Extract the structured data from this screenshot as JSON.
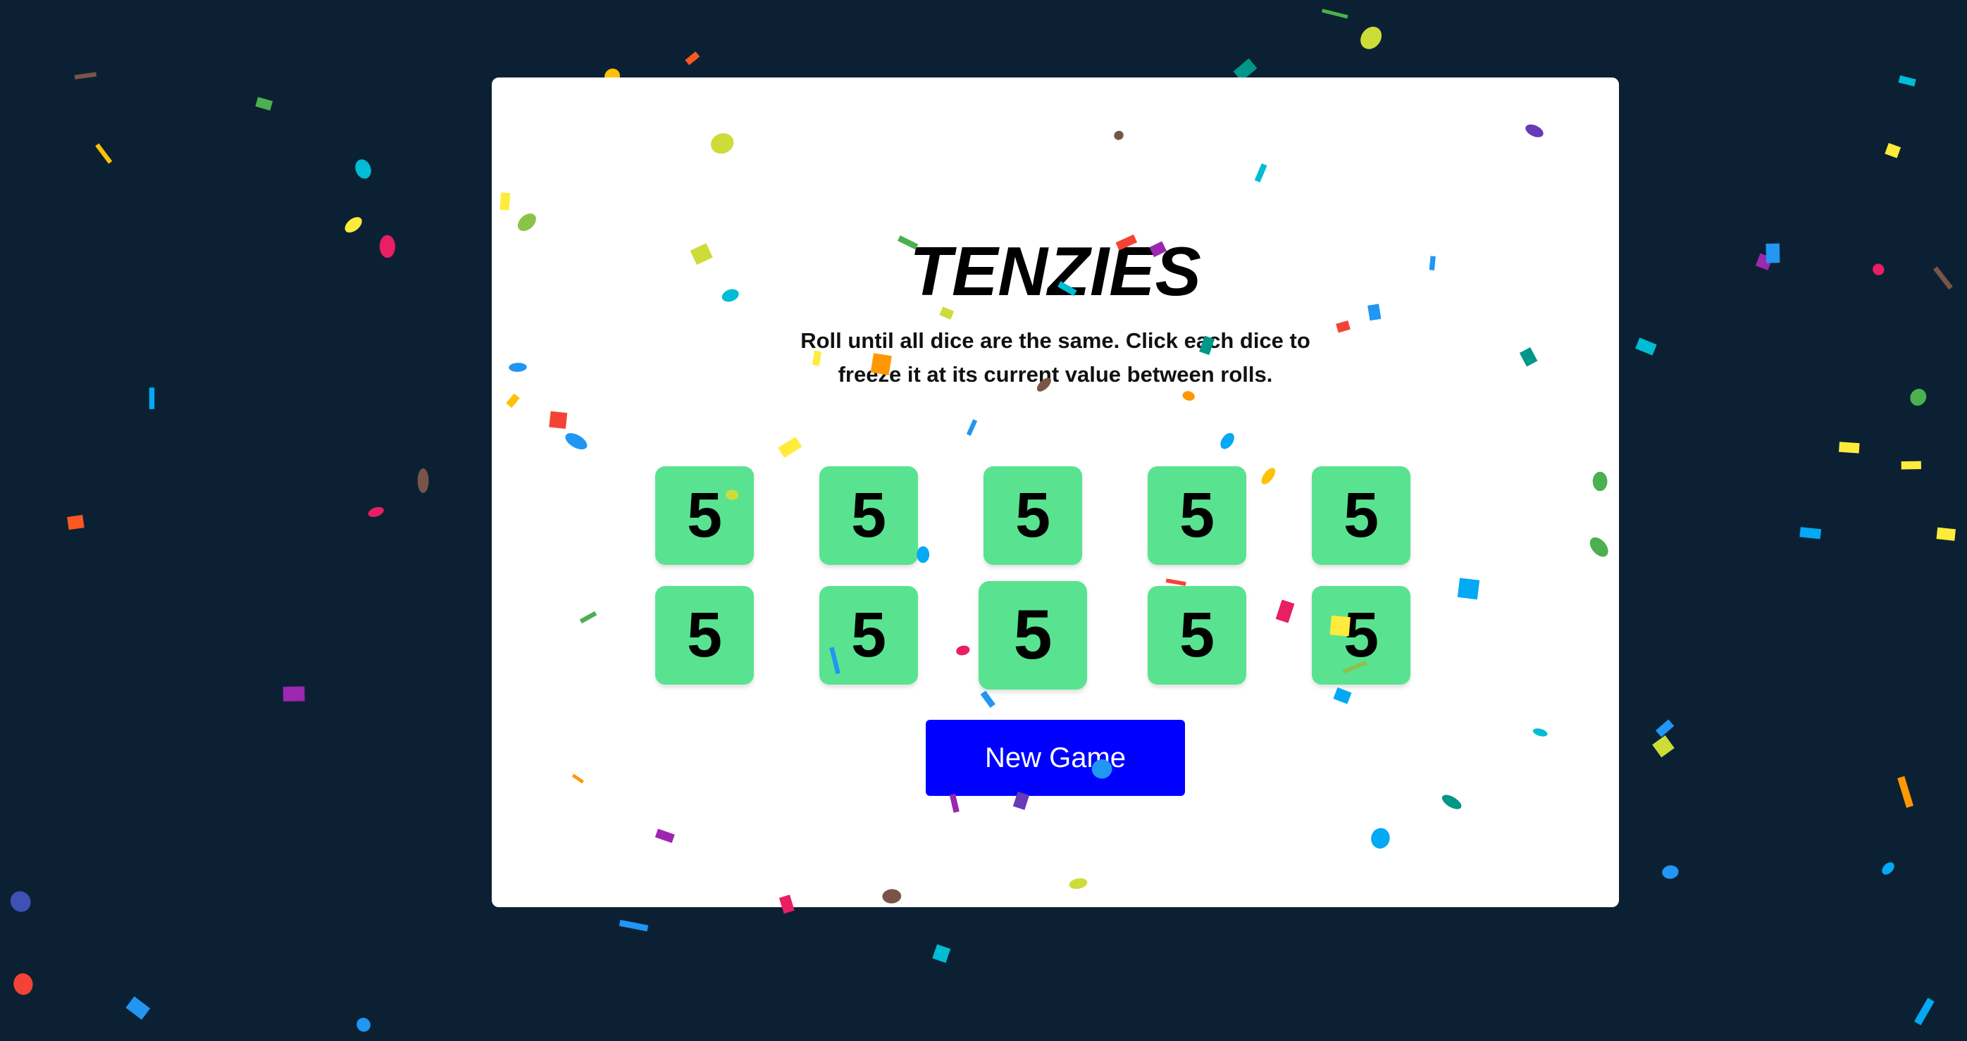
{
  "game": {
    "title": "TENZIES",
    "instructions": "Roll until all dice are the same. Click each dice to freeze it at its current value between rolls.",
    "dice": [
      {
        "value": "5",
        "held": true
      },
      {
        "value": "5",
        "held": true
      },
      {
        "value": "5",
        "held": true
      },
      {
        "value": "5",
        "held": true
      },
      {
        "value": "5",
        "held": true
      },
      {
        "value": "5",
        "held": true
      },
      {
        "value": "5",
        "held": true
      },
      {
        "value": "5",
        "held": true
      },
      {
        "value": "5",
        "held": true
      },
      {
        "value": "5",
        "held": true
      }
    ],
    "new_game_label": "New Game",
    "won": true
  },
  "colors": {
    "background": "#0b2133",
    "card": "#ffffff",
    "die_held": "#59e391",
    "button": "#0000ff",
    "button_text": "#ffffff",
    "confetti_palette": [
      "#f44336",
      "#e91e63",
      "#9c27b0",
      "#673ab7",
      "#3f51b5",
      "#2196f3",
      "#03a9f4",
      "#00bcd4",
      "#009688",
      "#4caf50",
      "#8bc34a",
      "#cddc39",
      "#ffeb3b",
      "#ffc107",
      "#ff9800",
      "#ff5722",
      "#795548"
    ]
  }
}
